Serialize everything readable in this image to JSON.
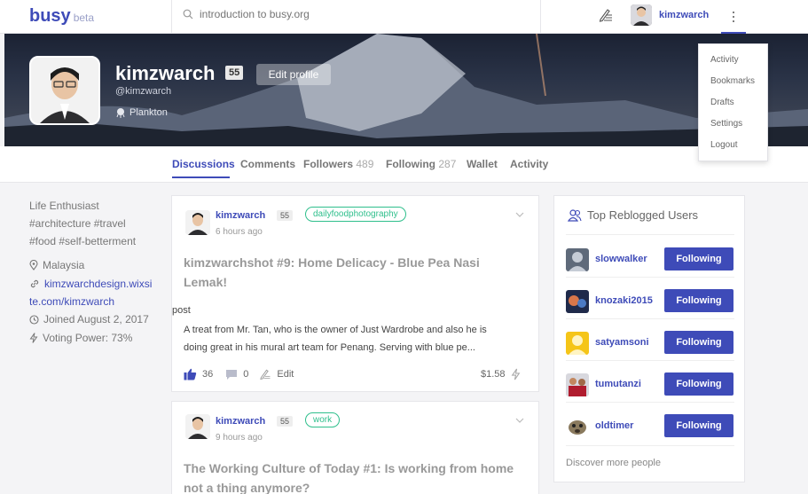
{
  "topbar": {
    "brand": "busy",
    "brand_tag": "beta",
    "search_placeholder": "introduction to busy.org",
    "username": "kimzwarch"
  },
  "profile": {
    "name": "kimzwarch",
    "reputation": "55",
    "edit_label": "Edit profile",
    "handle": "@kimzwarch",
    "rank": "Plankton"
  },
  "dropdown": {
    "items": [
      "Activity",
      "Bookmarks",
      "Drafts",
      "Settings",
      "Logout"
    ]
  },
  "tabs": [
    {
      "label": "Discussions",
      "count": ""
    },
    {
      "label": "Comments",
      "count": ""
    },
    {
      "label": "Followers",
      "count": "489"
    },
    {
      "label": "Following",
      "count": "287"
    },
    {
      "label": "Wallet",
      "count": ""
    },
    {
      "label": "Activity",
      "count": ""
    }
  ],
  "sidebar": {
    "bio_line1": "Life Enthusiast",
    "bio_line2": "#architecture #travel",
    "bio_line3": "#food #self-betterment",
    "location": "Malaysia",
    "website_line1": "kimzwarchdesign.wixsi",
    "website_line2": "te.com/kimzwarch",
    "joined": "Joined August 2, 2017",
    "voting_power": "Voting Power: 73%"
  },
  "posts": [
    {
      "author": "kimzwarch",
      "reputation": "55",
      "tag": "dailyfoodphotography",
      "time": "6 hours ago",
      "title_line1": "kimzwarchshot #9: Home Delicacy - Blue Pea Nasi",
      "title_line2": "Lemak!",
      "post_label": "post",
      "body_line1": "A treat from Mr. Tan, who is the owner of Just Wardrobe and also he is",
      "body_line2": "doing great in his mural art team for Penang. Serving with blue pe...",
      "likes": "36",
      "comments": "0",
      "edit_label": "Edit",
      "payout": "$1.58"
    },
    {
      "author": "kimzwarch",
      "reputation": "55",
      "tag": "work",
      "time": "9 hours ago",
      "title_line1": "The Working Culture of Today #1: Is working from home",
      "title_line2": "not a thing anymore?"
    }
  ],
  "reblogged": {
    "title": "Top Reblogged Users",
    "follow_label": "Following",
    "users": [
      {
        "name": "slowwalker"
      },
      {
        "name": "knozaki2015"
      },
      {
        "name": "satyamsoni"
      },
      {
        "name": "tumutanzi"
      },
      {
        "name": "oldtimer"
      }
    ],
    "discover": "Discover more people"
  },
  "colors": {
    "accent": "#3e4bb8",
    "tag_green": "#2fbf8c"
  }
}
